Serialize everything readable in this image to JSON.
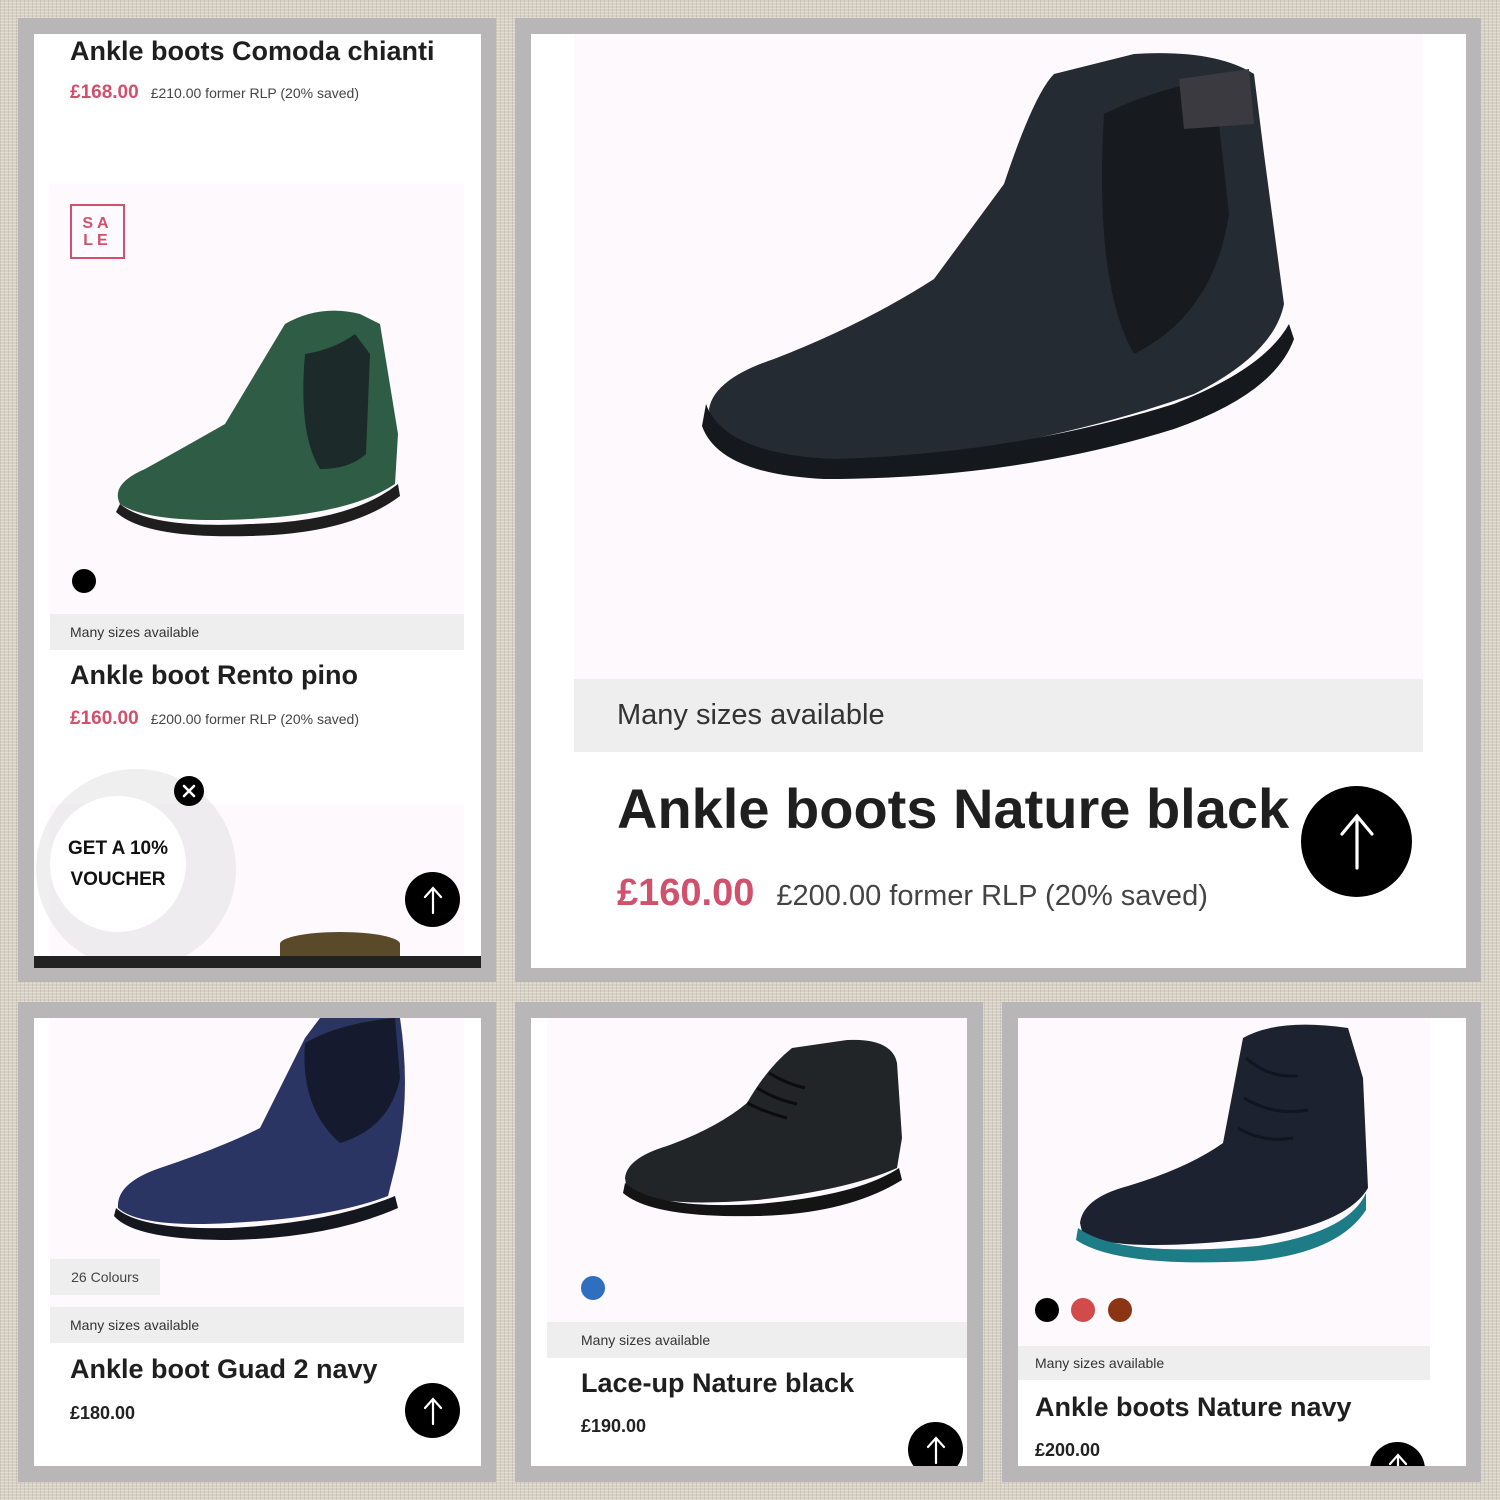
{
  "panel1": {
    "top_product": {
      "title": "Ankle boots Comoda chianti",
      "price": "£168.00",
      "former": "£210.00 former RLP (20% saved)"
    },
    "sale_badge": "SA\nLE",
    "product": {
      "title": "Ankle boot Rento pino",
      "price": "£160.00",
      "former": "£200.00 former RLP (20% saved)",
      "sizes": "Many sizes available"
    },
    "voucher": {
      "line1": "GET A 10%",
      "line2": "VOUCHER"
    }
  },
  "panel2": {
    "title": "Ankle boots Nature black",
    "price": "£160.00",
    "former": "£200.00 former RLP (20% saved)",
    "sizes": "Many sizes available"
  },
  "panel3": {
    "title": "Ankle boot Guad 2 navy",
    "price": "£180.00",
    "colours": "26 Colours",
    "sizes": "Many sizes available"
  },
  "panel4": {
    "title": "Lace-up Nature black",
    "price": "£190.00",
    "sizes": "Many sizes available"
  },
  "panel5": {
    "title": "Ankle boots Nature navy",
    "price": "£200.00",
    "sizes": "Many sizes available"
  },
  "colors": {
    "price_red": "#d1506c",
    "swatch_black": "#000000",
    "swatch_blue": "#2f6fc0",
    "swatch_red": "#d14b4b",
    "swatch_brown": "#8b3514",
    "boot_green": "#2f5c45",
    "boot_navy": "#2b3563"
  }
}
